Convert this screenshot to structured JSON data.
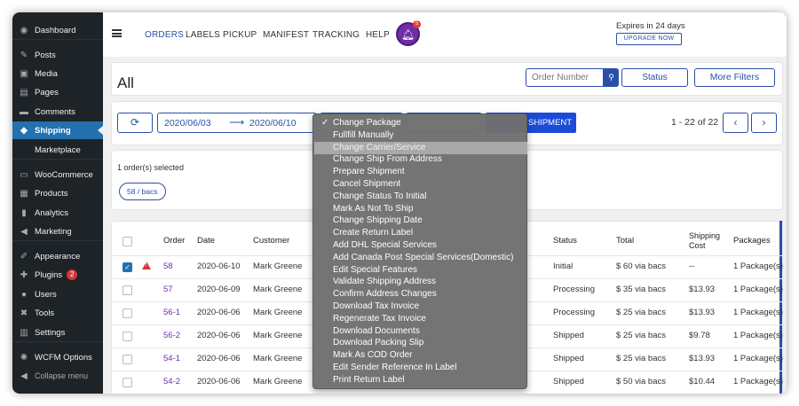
{
  "sidebar": {
    "items": [
      {
        "label": "Dashboard",
        "icon": "dashboard-icon",
        "glyph": "◉"
      },
      {
        "label": "Posts",
        "icon": "pin-icon",
        "glyph": "✎"
      },
      {
        "label": "Media",
        "icon": "media-icon",
        "glyph": "▣"
      },
      {
        "label": "Pages",
        "icon": "pages-icon",
        "glyph": "▤"
      },
      {
        "label": "Comments",
        "icon": "comments-icon",
        "glyph": "▬"
      },
      {
        "label": "Shipping",
        "icon": "shipping-icon",
        "glyph": "◆"
      },
      {
        "label": "Marketplace",
        "icon": "marketplace-icon",
        "glyph": ""
      },
      {
        "label": "WooCommerce",
        "icon": "woocommerce-icon",
        "glyph": "▭"
      },
      {
        "label": "Products",
        "icon": "products-icon",
        "glyph": "▦"
      },
      {
        "label": "Analytics",
        "icon": "analytics-icon",
        "glyph": "▮"
      },
      {
        "label": "Marketing",
        "icon": "marketing-icon",
        "glyph": "◀"
      },
      {
        "label": "Appearance",
        "icon": "appearance-icon",
        "glyph": "✐"
      },
      {
        "label": "Plugins",
        "icon": "plugins-icon",
        "glyph": "✚",
        "badge": "2"
      },
      {
        "label": "Users",
        "icon": "users-icon",
        "glyph": "●"
      },
      {
        "label": "Tools",
        "icon": "tools-icon",
        "glyph": "✖"
      },
      {
        "label": "Settings",
        "icon": "settings-icon",
        "glyph": "▥"
      },
      {
        "label": "WCFM Options",
        "icon": "gear-icon",
        "glyph": "✺"
      },
      {
        "label": "Collapse menu",
        "icon": "collapse-icon",
        "glyph": "◀"
      }
    ]
  },
  "topnav": {
    "items": [
      "ORDERS",
      "LABELS",
      "PICKUP",
      "MANIFEST",
      "TRACKING",
      "HELP"
    ],
    "notification_count": "5",
    "expires": "Expires in 24 days",
    "upgrade": "UPGRADE NOW"
  },
  "header": {
    "title": "All",
    "search_placeholder": "Order Number",
    "status_label": "Status",
    "more_filters_label": "More Filters"
  },
  "toolbar": {
    "date_from": "2020/06/03",
    "date_to": "2020/06/10",
    "ship_label": "SHIPMENT",
    "pager_text": "1 - 22 of 22"
  },
  "selection": {
    "text": "1 order(s) selected",
    "chip": "58 / bacs"
  },
  "table": {
    "headers": {
      "order": "Order",
      "date": "Date",
      "customer": "Customer",
      "status": "Status",
      "total": "Total",
      "shipping_cost_1": "Shipping",
      "shipping_cost_2": "Cost",
      "packages": "Packages"
    },
    "rows": [
      {
        "order": "58",
        "date": "2020-06-10",
        "customer": "Mark Greene",
        "status": "Initial",
        "total": "$ 60 via bacs",
        "shipping": "--",
        "packages": "1 Package(s)",
        "checked": true,
        "warn": true
      },
      {
        "order": "57",
        "date": "2020-06-09",
        "customer": "Mark Greene",
        "status": "Processing",
        "total": "$ 35 via bacs",
        "shipping": "$13.93",
        "packages": "1 Package(s)"
      },
      {
        "order": "56-1",
        "date": "2020-06-06",
        "customer": "Mark Greene",
        "status": "Processing",
        "total": "$ 25 via bacs",
        "shipping": "$13.93",
        "packages": "1 Package(s)"
      },
      {
        "order": "56-2",
        "date": "2020-06-06",
        "customer": "Mark Greene",
        "status": "Shipped",
        "total": "$ 25 via bacs",
        "shipping": "$9.78",
        "packages": "1 Package(s)"
      },
      {
        "order": "54-1",
        "date": "2020-06-06",
        "customer": "Mark Greene",
        "status": "Shipped",
        "total": "$ 25 via bacs",
        "shipping": "$13.93",
        "packages": "1 Package(s)"
      },
      {
        "order": "54-2",
        "date": "2020-06-06",
        "customer": "Mark Greene",
        "status": "Shipped",
        "total": "$ 50 via bacs",
        "shipping": "$10.44",
        "packages": "1 Package(s)"
      }
    ]
  },
  "dropdown": {
    "selected": "Change Package",
    "highlighted": "Change Carrier/Service",
    "items": [
      "Change Package",
      "Fullfill Manually",
      "Change Carrier/Service",
      "Change Ship From Address",
      "Prepare Shipment",
      "Cancel Shipment",
      "Change Status To Initial",
      "Mark As Not To Ship",
      "Change Shipping Date",
      "Create Return Label",
      "Add DHL Special Services",
      "Add Canada Post Special Services(Domestic)",
      "Edit Special Features",
      "Validate Shipping Address",
      "Confirm Address Changes",
      "Download Tax Invoice",
      "Regenerate Tax Invoice",
      "Download Documents",
      "Download Packing Slip",
      "Mark As COD Order",
      "Edit Sender Reference In Label",
      "Print Return Label"
    ]
  },
  "colors": {
    "accent": "#2a4fa8",
    "sidebar_bg": "#1d2327",
    "sidebar_active": "#2271b1",
    "link": "#6f2da8"
  }
}
